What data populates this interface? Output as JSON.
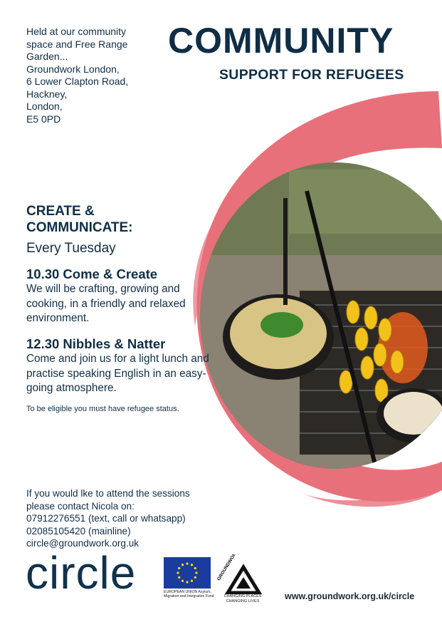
{
  "venue": {
    "lines": [
      "Held at our community",
      "space and Free Range",
      "Garden...",
      "Groundwork London,",
      "6 Lower Clapton Road,",
      "Hackney,",
      "London,",
      "E5 0PD"
    ]
  },
  "header": {
    "title": "COMMUNITY",
    "subtitle": "SUPPORT FOR REFUGEES"
  },
  "program": {
    "heading_line1": "CREATE &",
    "heading_line2": "COMMUNICATE:",
    "schedule": "Every Tuesday",
    "session1": {
      "title": "10.30 Come & Create",
      "body": "We will be crafting, growing and cooking, in a friendly and relaxed environment."
    },
    "session2": {
      "title": "12.30 Nibbles & Natter",
      "body": "Come and join us for a light lunch and practise speaking English in an easy-going atmosphere."
    },
    "eligibility": "To be eligible you must have refugee status."
  },
  "contact": {
    "lines": [
      "If you would lke to attend the sessions",
      "please contact Nicola on:",
      "07912276551 (text, call or whatsapp)",
      "02085105420 (mainline)",
      "circle@groundwork.org.uk"
    ]
  },
  "footer": {
    "circle_logo": "circle",
    "eu_text": "EUROPEAN UNION Asylum, Migration and Integration Fund",
    "groundwork_logo_text": "GROUNDWORK",
    "groundwork_tagline": "CHANGING PLACES CHANGING LIVES",
    "website": "www.groundwork.org.uk/circle"
  },
  "colors": {
    "navy": "#0f2e46",
    "brush_pink": "#e8707a",
    "eu_blue": "#1a3c9e",
    "eu_star": "#ffdd00"
  },
  "icons": {
    "eu_flag": "eu-flag-icon",
    "groundwork": "groundwork-triangle-icon"
  }
}
